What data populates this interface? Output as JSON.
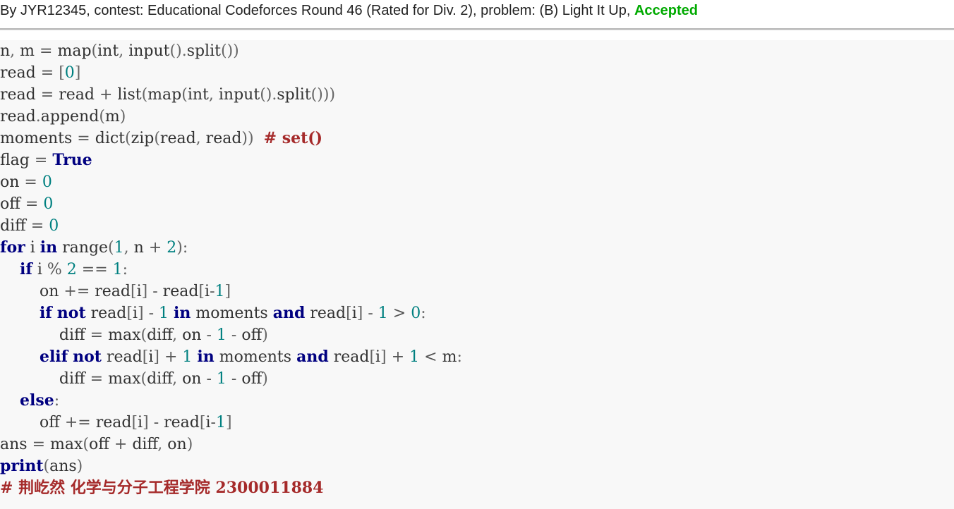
{
  "header": {
    "prefix": "By JYR12345, contest: Educational Codeforces Round 46 (Rated for Div. 2), problem: (B) Light It Up, ",
    "verdict": "Accepted",
    "verdict_color": "#00aa00"
  },
  "code": {
    "language_hint": "python",
    "lines": [
      "n, m = map(int, input().split())",
      "read = [0]",
      "read = read + list(map(int, input().split()))",
      "read.append(m)",
      "moments = dict(zip(read, read))  # set()",
      "flag = True",
      "on = 0",
      "off = 0",
      "diff = 0",
      "for i in range(1, n + 2):",
      "    if i % 2 == 1:",
      "        on += read[i] - read[i-1]",
      "        if not read[i] - 1 in moments and read[i] - 1 > 0:",
      "            diff = max(diff, on - 1 - off)",
      "        elif not read[i] + 1 in moments and read[i] + 1 < m:",
      "            diff = max(diff, on - 1 - off)",
      "    else:",
      "        off += read[i] - read[i-1]",
      "ans = max(off + diff, on)",
      "print(ans)",
      "# 荆屹然 化学与分子工程学院 2300011884"
    ]
  },
  "colors": {
    "keyword": "#000080",
    "number": "#008080",
    "comment": "#a52a2a",
    "panel_background": "#f8f8f8"
  }
}
